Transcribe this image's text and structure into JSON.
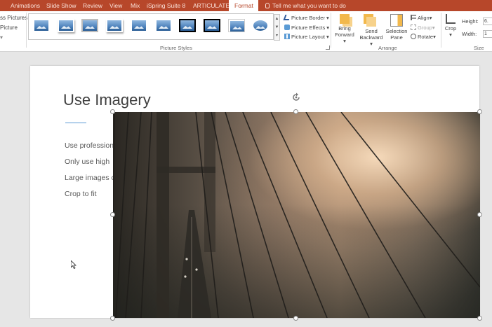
{
  "tabs": [
    {
      "label": "Animations",
      "active": false
    },
    {
      "label": "Slide Show",
      "active": false
    },
    {
      "label": "Review",
      "active": false
    },
    {
      "label": "View",
      "active": false
    },
    {
      "label": "Mix",
      "active": false
    },
    {
      "label": "iSpring Suite 8",
      "active": false
    },
    {
      "label": "ARTICULATE",
      "active": false
    },
    {
      "label": "Format",
      "active": true
    }
  ],
  "tell_me": "Tell me what you want to do",
  "ribbon": {
    "adjust": {
      "change_pictures": "ss Pictures",
      "reset_picture": "Picture"
    },
    "picture_styles": {
      "group_label": "Picture Styles",
      "picture_border": "Picture Border",
      "picture_effects": "Picture Effects",
      "picture_layout": "Picture Layout"
    },
    "arrange": {
      "group_label": "Arrange",
      "bring_forward": [
        "Bring",
        "Forward"
      ],
      "send_backward": [
        "Send",
        "Backward"
      ],
      "selection_pane": [
        "Selection",
        "Pane"
      ],
      "align": "Align",
      "group": "Group",
      "rotate": "Rotate"
    },
    "size": {
      "group_label": "Size",
      "crop": "Crop",
      "height_label": "Height:",
      "width_label": "Width:",
      "height_value": "6.",
      "width_value": "1"
    }
  },
  "slide": {
    "title": "Use Imagery",
    "bullets": [
      "Use profession",
      "Only use high",
      "Large images c",
      "Crop to fit"
    ]
  },
  "colors": {
    "accent": "#b7472a",
    "title_line": "#5b9bd5"
  }
}
